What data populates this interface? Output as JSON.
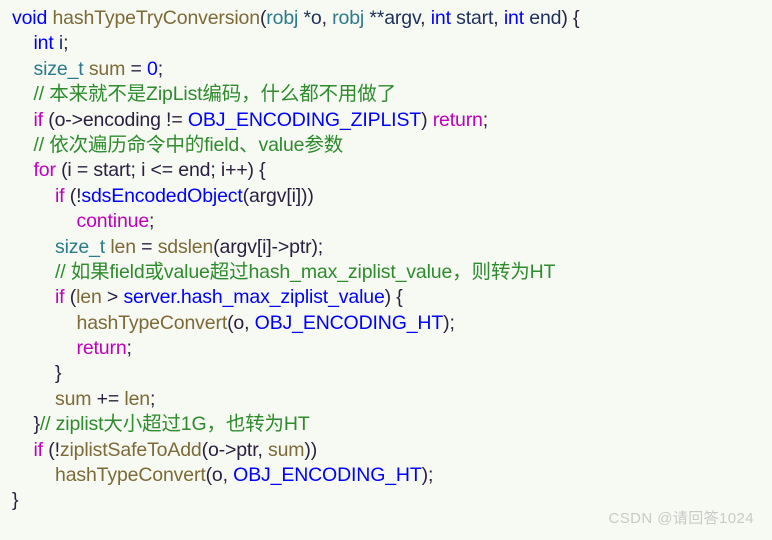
{
  "document": {
    "kind": "source-code-screenshot",
    "language": "c",
    "background_color": "#f7faf2",
    "font_size_px": 19.5,
    "line_height_px": 25.4
  },
  "palette": {
    "keyword": "#0000ff",
    "control": "#bf00bf",
    "type": "#2b7b8c",
    "function": "#7d6a39",
    "variable": "#7d6a39",
    "constant": "#0000ff",
    "identifier": "#0000ff",
    "punctuation": "#2b2040",
    "comment": "#2e8b2e",
    "plain": "#1f1f3a",
    "parameter": "#1f2f5c",
    "watermark": "#c9c9c9"
  },
  "code": {
    "full_text": "void hashTypeTryConversion(robj *o, robj **argv, int start, int end) {\n    int i;\n    size_t sum = 0;\n    // 本来就不是ZipList编码，什么都不用做了\n    if (o->encoding != OBJ_ENCODING_ZIPLIST) return;\n    // 依次遍历命令中的field、value参数\n    for (i = start; i <= end; i++) {\n        if (!sdsEncodedObject(argv[i]))\n            continue;\n        size_t len = sdslen(argv[i]->ptr);\n        // 如果field或value超过hash_max_ziplist_value，则转为HT\n        if (len > server.hash_max_ziplist_value) {\n            hashTypeConvert(o, OBJ_ENCODING_HT);\n            return;\n        }\n        sum += len;\n    }// ziplist大小超过1G，也转为HT\n    if (!ziplistSafeToAdd(o->ptr, sum))\n        hashTypeConvert(o, OBJ_ENCODING_HT);\n}",
    "lines": [
      {
        "n": 1,
        "indent": 0,
        "tokens": [
          {
            "t": "void",
            "c": "t-kw"
          },
          {
            "t": " ",
            "c": "t-plain"
          },
          {
            "t": "hashTypeTryConversion",
            "c": "t-fn"
          },
          {
            "t": "(",
            "c": "t-punct"
          },
          {
            "t": "robj",
            "c": "t-type"
          },
          {
            "t": " *o",
            "c": "t-param"
          },
          {
            "t": ", ",
            "c": "t-punct"
          },
          {
            "t": "robj",
            "c": "t-type"
          },
          {
            "t": " **argv",
            "c": "t-param"
          },
          {
            "t": ", ",
            "c": "t-punct"
          },
          {
            "t": "int",
            "c": "t-kw"
          },
          {
            "t": " start",
            "c": "t-param"
          },
          {
            "t": ", ",
            "c": "t-punct"
          },
          {
            "t": "int",
            "c": "t-kw"
          },
          {
            "t": " end",
            "c": "t-param"
          },
          {
            "t": ") {",
            "c": "t-punct"
          }
        ]
      },
      {
        "n": 2,
        "indent": 1,
        "tokens": [
          {
            "t": "int",
            "c": "t-kw"
          },
          {
            "t": " i",
            "c": "t-param"
          },
          {
            "t": ";",
            "c": "t-punct"
          }
        ]
      },
      {
        "n": 3,
        "indent": 1,
        "tokens": [
          {
            "t": "size_t",
            "c": "t-type"
          },
          {
            "t": " ",
            "c": "t-plain"
          },
          {
            "t": "sum",
            "c": "t-var"
          },
          {
            "t": " ",
            "c": "t-plain"
          },
          {
            "t": "=",
            "c": "t-punct"
          },
          {
            "t": " ",
            "c": "t-plain"
          },
          {
            "t": "0",
            "c": "t-num"
          },
          {
            "t": ";",
            "c": "t-punct"
          }
        ]
      },
      {
        "n": 4,
        "indent": 1,
        "tokens": [
          {
            "t": "// 本来就不是ZipList编码，什么都不用做了",
            "c": "t-comment"
          }
        ]
      },
      {
        "n": 5,
        "indent": 1,
        "tokens": [
          {
            "t": "if",
            "c": "t-ctrl"
          },
          {
            "t": " (o->encoding != ",
            "c": "t-punct"
          },
          {
            "t": "OBJ_ENCODING_ZIPLIST",
            "c": "t-const"
          },
          {
            "t": ") ",
            "c": "t-punct"
          },
          {
            "t": "return",
            "c": "t-ctrl"
          },
          {
            "t": ";",
            "c": "t-punct"
          }
        ]
      },
      {
        "n": 6,
        "indent": 1,
        "tokens": [
          {
            "t": "// 依次遍历命令中的field、value参数",
            "c": "t-comment"
          }
        ]
      },
      {
        "n": 7,
        "indent": 1,
        "tokens": [
          {
            "t": "for",
            "c": "t-ctrl"
          },
          {
            "t": " (i = start; i <= end; i++) {",
            "c": "t-punct"
          }
        ]
      },
      {
        "n": 8,
        "indent": 2,
        "tokens": [
          {
            "t": "if",
            "c": "t-ctrl"
          },
          {
            "t": " (!",
            "c": "t-punct"
          },
          {
            "t": "sdsEncodedObject",
            "c": "t-id"
          },
          {
            "t": "(argv[i]))",
            "c": "t-punct"
          }
        ]
      },
      {
        "n": 9,
        "indent": 3,
        "tokens": [
          {
            "t": "continue",
            "c": "t-ctrl"
          },
          {
            "t": ";",
            "c": "t-punct"
          }
        ]
      },
      {
        "n": 10,
        "indent": 2,
        "tokens": [
          {
            "t": "size_t",
            "c": "t-type"
          },
          {
            "t": " ",
            "c": "t-plain"
          },
          {
            "t": "len",
            "c": "t-var"
          },
          {
            "t": " = ",
            "c": "t-punct"
          },
          {
            "t": "sdslen",
            "c": "t-var"
          },
          {
            "t": "(argv[i]->ptr);",
            "c": "t-punct"
          }
        ]
      },
      {
        "n": 11,
        "indent": 2,
        "tokens": [
          {
            "t": "// 如果field或value超过hash_max_ziplist_value，则转为HT",
            "c": "t-comment"
          }
        ]
      },
      {
        "n": 12,
        "indent": 2,
        "tokens": [
          {
            "t": "if",
            "c": "t-ctrl"
          },
          {
            "t": " (",
            "c": "t-punct"
          },
          {
            "t": "len",
            "c": "t-var"
          },
          {
            "t": " > ",
            "c": "t-punct"
          },
          {
            "t": "server.hash_max_ziplist_value",
            "c": "t-const"
          },
          {
            "t": ") {",
            "c": "t-punct"
          }
        ]
      },
      {
        "n": 13,
        "indent": 3,
        "tokens": [
          {
            "t": "hashTypeConvert",
            "c": "t-fn"
          },
          {
            "t": "(o, ",
            "c": "t-punct"
          },
          {
            "t": "OBJ_ENCODING_HT",
            "c": "t-const"
          },
          {
            "t": ");",
            "c": "t-punct"
          }
        ]
      },
      {
        "n": 14,
        "indent": 3,
        "tokens": [
          {
            "t": "return",
            "c": "t-ctrl"
          },
          {
            "t": ";",
            "c": "t-punct"
          }
        ]
      },
      {
        "n": 15,
        "indent": 2,
        "tokens": [
          {
            "t": "}",
            "c": "t-punct"
          }
        ]
      },
      {
        "n": 16,
        "indent": 2,
        "tokens": [
          {
            "t": "sum",
            "c": "t-var"
          },
          {
            "t": " += ",
            "c": "t-punct"
          },
          {
            "t": "len",
            "c": "t-var"
          },
          {
            "t": ";",
            "c": "t-punct"
          }
        ]
      },
      {
        "n": 17,
        "indent": 1,
        "tokens": [
          {
            "t": "}",
            "c": "t-punct"
          },
          {
            "t": "// ziplist大小超过1G，也转为HT",
            "c": "t-comment"
          }
        ]
      },
      {
        "n": 18,
        "indent": 1,
        "tokens": [
          {
            "t": "if",
            "c": "t-ctrl"
          },
          {
            "t": " (!",
            "c": "t-punct"
          },
          {
            "t": "ziplistSafeToAdd",
            "c": "t-fn"
          },
          {
            "t": "(o->ptr, ",
            "c": "t-punct"
          },
          {
            "t": "sum",
            "c": "t-var"
          },
          {
            "t": "))",
            "c": "t-punct"
          }
        ]
      },
      {
        "n": 19,
        "indent": 2,
        "tokens": [
          {
            "t": "hashTypeConvert",
            "c": "t-fn"
          },
          {
            "t": "(o, ",
            "c": "t-punct"
          },
          {
            "t": "OBJ_ENCODING_HT",
            "c": "t-const"
          },
          {
            "t": ");",
            "c": "t-punct"
          }
        ]
      },
      {
        "n": 20,
        "indent": 0,
        "tokens": [
          {
            "t": "}",
            "c": "t-punct"
          }
        ]
      }
    ]
  },
  "watermark": {
    "text": "CSDN @请回答1024"
  }
}
